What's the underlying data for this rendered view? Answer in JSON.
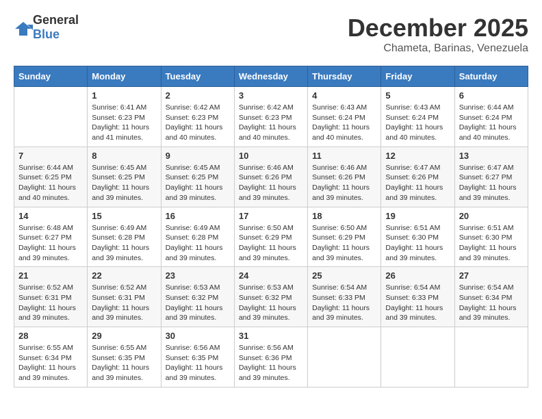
{
  "header": {
    "logo_general": "General",
    "logo_blue": "Blue",
    "month_title": "December 2025",
    "location": "Chameta, Barinas, Venezuela"
  },
  "days_of_week": [
    "Sunday",
    "Monday",
    "Tuesday",
    "Wednesday",
    "Thursday",
    "Friday",
    "Saturday"
  ],
  "weeks": [
    [
      {
        "day": "",
        "sunrise": "",
        "sunset": "",
        "daylight": ""
      },
      {
        "day": "1",
        "sunrise": "Sunrise: 6:41 AM",
        "sunset": "Sunset: 6:23 PM",
        "daylight": "Daylight: 11 hours and 41 minutes."
      },
      {
        "day": "2",
        "sunrise": "Sunrise: 6:42 AM",
        "sunset": "Sunset: 6:23 PM",
        "daylight": "Daylight: 11 hours and 40 minutes."
      },
      {
        "day": "3",
        "sunrise": "Sunrise: 6:42 AM",
        "sunset": "Sunset: 6:23 PM",
        "daylight": "Daylight: 11 hours and 40 minutes."
      },
      {
        "day": "4",
        "sunrise": "Sunrise: 6:43 AM",
        "sunset": "Sunset: 6:24 PM",
        "daylight": "Daylight: 11 hours and 40 minutes."
      },
      {
        "day": "5",
        "sunrise": "Sunrise: 6:43 AM",
        "sunset": "Sunset: 6:24 PM",
        "daylight": "Daylight: 11 hours and 40 minutes."
      },
      {
        "day": "6",
        "sunrise": "Sunrise: 6:44 AM",
        "sunset": "Sunset: 6:24 PM",
        "daylight": "Daylight: 11 hours and 40 minutes."
      }
    ],
    [
      {
        "day": "7",
        "sunrise": "Sunrise: 6:44 AM",
        "sunset": "Sunset: 6:25 PM",
        "daylight": "Daylight: 11 hours and 40 minutes."
      },
      {
        "day": "8",
        "sunrise": "Sunrise: 6:45 AM",
        "sunset": "Sunset: 6:25 PM",
        "daylight": "Daylight: 11 hours and 39 minutes."
      },
      {
        "day": "9",
        "sunrise": "Sunrise: 6:45 AM",
        "sunset": "Sunset: 6:25 PM",
        "daylight": "Daylight: 11 hours and 39 minutes."
      },
      {
        "day": "10",
        "sunrise": "Sunrise: 6:46 AM",
        "sunset": "Sunset: 6:26 PM",
        "daylight": "Daylight: 11 hours and 39 minutes."
      },
      {
        "day": "11",
        "sunrise": "Sunrise: 6:46 AM",
        "sunset": "Sunset: 6:26 PM",
        "daylight": "Daylight: 11 hours and 39 minutes."
      },
      {
        "day": "12",
        "sunrise": "Sunrise: 6:47 AM",
        "sunset": "Sunset: 6:26 PM",
        "daylight": "Daylight: 11 hours and 39 minutes."
      },
      {
        "day": "13",
        "sunrise": "Sunrise: 6:47 AM",
        "sunset": "Sunset: 6:27 PM",
        "daylight": "Daylight: 11 hours and 39 minutes."
      }
    ],
    [
      {
        "day": "14",
        "sunrise": "Sunrise: 6:48 AM",
        "sunset": "Sunset: 6:27 PM",
        "daylight": "Daylight: 11 hours and 39 minutes."
      },
      {
        "day": "15",
        "sunrise": "Sunrise: 6:49 AM",
        "sunset": "Sunset: 6:28 PM",
        "daylight": "Daylight: 11 hours and 39 minutes."
      },
      {
        "day": "16",
        "sunrise": "Sunrise: 6:49 AM",
        "sunset": "Sunset: 6:28 PM",
        "daylight": "Daylight: 11 hours and 39 minutes."
      },
      {
        "day": "17",
        "sunrise": "Sunrise: 6:50 AM",
        "sunset": "Sunset: 6:29 PM",
        "daylight": "Daylight: 11 hours and 39 minutes."
      },
      {
        "day": "18",
        "sunrise": "Sunrise: 6:50 AM",
        "sunset": "Sunset: 6:29 PM",
        "daylight": "Daylight: 11 hours and 39 minutes."
      },
      {
        "day": "19",
        "sunrise": "Sunrise: 6:51 AM",
        "sunset": "Sunset: 6:30 PM",
        "daylight": "Daylight: 11 hours and 39 minutes."
      },
      {
        "day": "20",
        "sunrise": "Sunrise: 6:51 AM",
        "sunset": "Sunset: 6:30 PM",
        "daylight": "Daylight: 11 hours and 39 minutes."
      }
    ],
    [
      {
        "day": "21",
        "sunrise": "Sunrise: 6:52 AM",
        "sunset": "Sunset: 6:31 PM",
        "daylight": "Daylight: 11 hours and 39 minutes."
      },
      {
        "day": "22",
        "sunrise": "Sunrise: 6:52 AM",
        "sunset": "Sunset: 6:31 PM",
        "daylight": "Daylight: 11 hours and 39 minutes."
      },
      {
        "day": "23",
        "sunrise": "Sunrise: 6:53 AM",
        "sunset": "Sunset: 6:32 PM",
        "daylight": "Daylight: 11 hours and 39 minutes."
      },
      {
        "day": "24",
        "sunrise": "Sunrise: 6:53 AM",
        "sunset": "Sunset: 6:32 PM",
        "daylight": "Daylight: 11 hours and 39 minutes."
      },
      {
        "day": "25",
        "sunrise": "Sunrise: 6:54 AM",
        "sunset": "Sunset: 6:33 PM",
        "daylight": "Daylight: 11 hours and 39 minutes."
      },
      {
        "day": "26",
        "sunrise": "Sunrise: 6:54 AM",
        "sunset": "Sunset: 6:33 PM",
        "daylight": "Daylight: 11 hours and 39 minutes."
      },
      {
        "day": "27",
        "sunrise": "Sunrise: 6:54 AM",
        "sunset": "Sunset: 6:34 PM",
        "daylight": "Daylight: 11 hours and 39 minutes."
      }
    ],
    [
      {
        "day": "28",
        "sunrise": "Sunrise: 6:55 AM",
        "sunset": "Sunset: 6:34 PM",
        "daylight": "Daylight: 11 hours and 39 minutes."
      },
      {
        "day": "29",
        "sunrise": "Sunrise: 6:55 AM",
        "sunset": "Sunset: 6:35 PM",
        "daylight": "Daylight: 11 hours and 39 minutes."
      },
      {
        "day": "30",
        "sunrise": "Sunrise: 6:56 AM",
        "sunset": "Sunset: 6:35 PM",
        "daylight": "Daylight: 11 hours and 39 minutes."
      },
      {
        "day": "31",
        "sunrise": "Sunrise: 6:56 AM",
        "sunset": "Sunset: 6:36 PM",
        "daylight": "Daylight: 11 hours and 39 minutes."
      },
      {
        "day": "",
        "sunrise": "",
        "sunset": "",
        "daylight": ""
      },
      {
        "day": "",
        "sunrise": "",
        "sunset": "",
        "daylight": ""
      },
      {
        "day": "",
        "sunrise": "",
        "sunset": "",
        "daylight": ""
      }
    ]
  ]
}
